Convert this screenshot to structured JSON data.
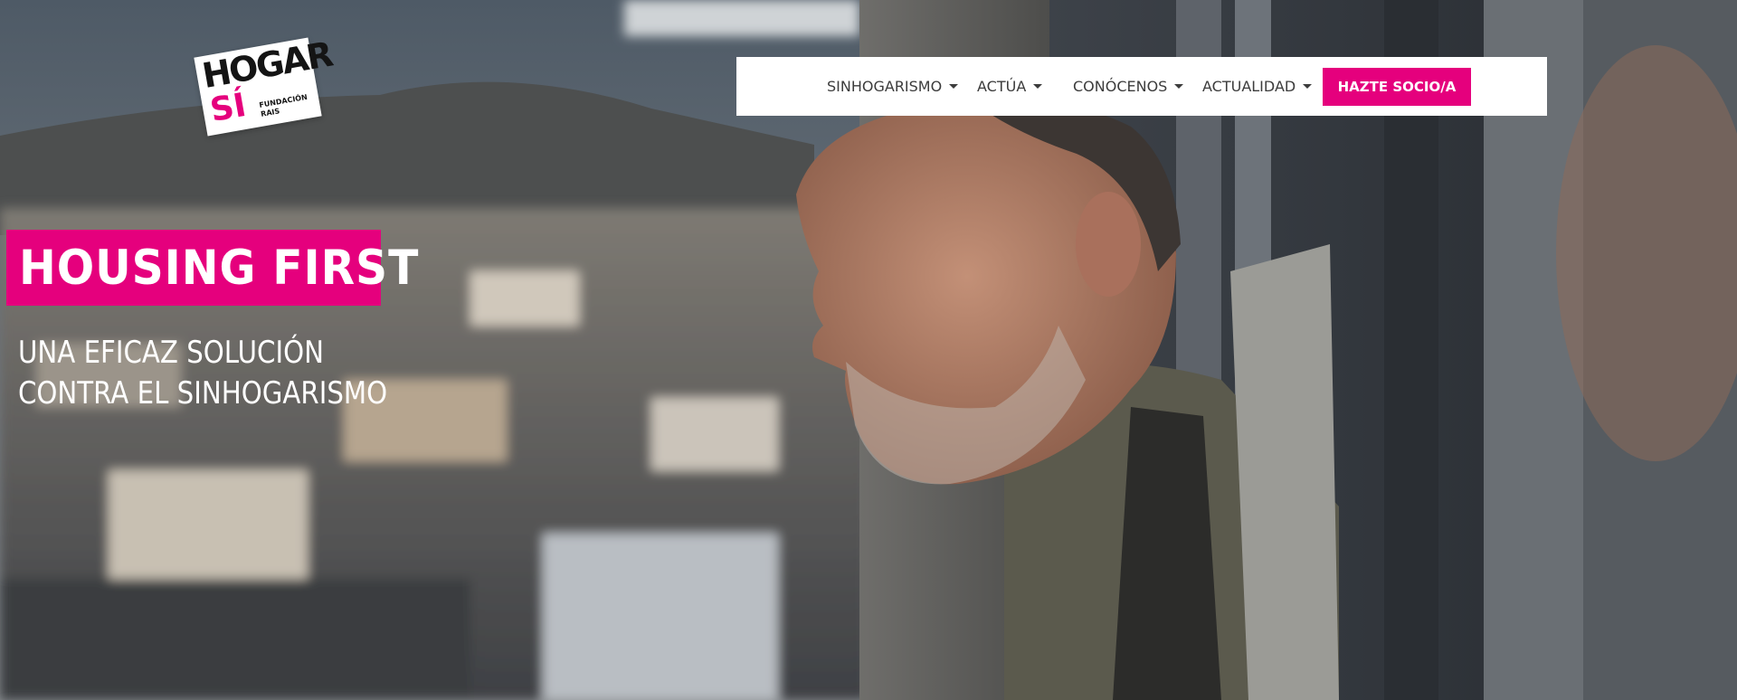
{
  "logo": {
    "line1": "HOGAR",
    "line2": "SÍ",
    "line3": "FUNDACIÓN RAIS"
  },
  "nav": {
    "items": [
      {
        "label": "SINHOGARISMO"
      },
      {
        "label": "ACTÚA"
      },
      {
        "label": "CONÓCENOS"
      },
      {
        "label": "ACTUALIDAD"
      }
    ],
    "cta_label": "HAZTE SOCIO/A",
    "icon": "chevron-down-icon"
  },
  "hero": {
    "title": "HOUSING FIRST",
    "subtitle_line1": "UNA EFICAZ SOLUCIÓN",
    "subtitle_line2": "CONTRA EL SINHOGARISMO"
  },
  "colors": {
    "accent": "#e5007d",
    "navbar_bg": "#ffffff",
    "text_light": "#ffffff"
  }
}
